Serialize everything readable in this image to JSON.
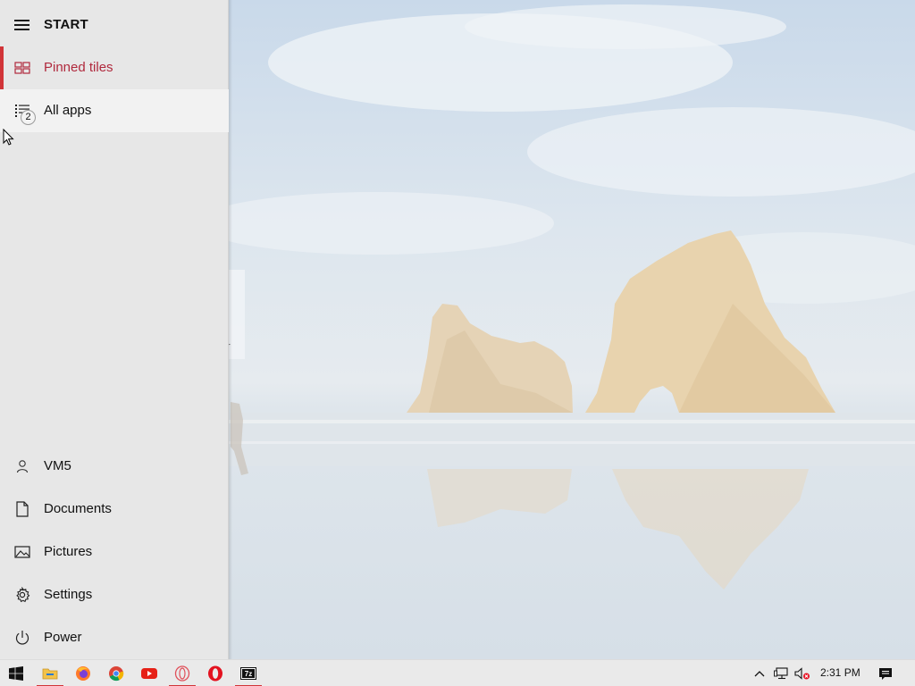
{
  "start_menu": {
    "title": "START",
    "items": [
      {
        "label": "Pinned tiles",
        "icon": "pinned-tiles-icon",
        "state": "selected"
      },
      {
        "label": "All apps",
        "icon": "all-apps-icon",
        "badge": "2",
        "state": "hover"
      }
    ],
    "bottom_items": [
      {
        "label": "VM5",
        "icon": "user-icon"
      },
      {
        "label": "Documents",
        "icon": "document-icon"
      },
      {
        "label": "Pictures",
        "icon": "pictures-icon"
      },
      {
        "label": "Settings",
        "icon": "gear-icon"
      },
      {
        "label": "Power",
        "icon": "power-icon"
      }
    ]
  },
  "desktop_peek": {
    "partial_char": "r"
  },
  "taskbar": {
    "start_icon": "windows-logo-icon",
    "apps": [
      {
        "name": "file-explorer",
        "icon": "folder-icon",
        "running": true
      },
      {
        "name": "firefox",
        "icon": "firefox-icon",
        "running": false
      },
      {
        "name": "chrome",
        "icon": "chrome-icon",
        "running": false
      },
      {
        "name": "youtube",
        "icon": "youtube-icon",
        "running": false
      },
      {
        "name": "opera-gx",
        "icon": "opera-outline-icon",
        "running": true
      },
      {
        "name": "opera",
        "icon": "opera-icon",
        "running": false
      },
      {
        "name": "7-zip",
        "icon": "7zip-icon",
        "running": true
      }
    ],
    "tray": {
      "clock": "2:31 PM",
      "icons": [
        "chevron-up-icon",
        "network-icon",
        "volume-muted-icon",
        "action-center-icon"
      ]
    }
  },
  "colors": {
    "accent": "#d13438",
    "active_label": "#b0293d",
    "menu_bg": "#e7e7e7",
    "taskbar_bg": "#eaeaea"
  }
}
